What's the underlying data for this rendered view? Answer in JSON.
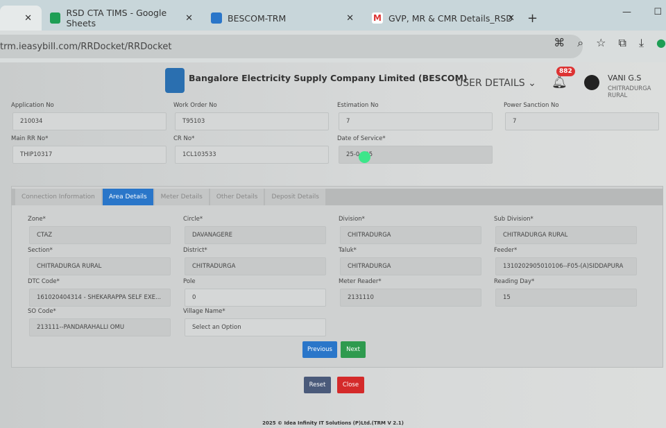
{
  "browser": {
    "tabs": [
      {
        "title": "",
        "close": "✕"
      },
      {
        "title": "RSD CTA TIMS - Google Sheets",
        "close": "✕"
      },
      {
        "title": "BESCOM-TRM",
        "close": "✕"
      },
      {
        "title": "GVP, MR & CMR Details_RSD",
        "close": "✕"
      }
    ],
    "new_tab": "+",
    "minimize": "—",
    "maximize": "☐",
    "url": "trm.ieasybill.com/RRDocket/RRDocket"
  },
  "header": {
    "company": "Bangalore Electricity Supply Company Limited (BESCOM)",
    "user_details": "USER DETAILS",
    "notifications": "882",
    "user_name": "VANI G.S",
    "user_location": "CHITRADURGA RURAL"
  },
  "top_fields": [
    {
      "label": "Application No",
      "value": "210034"
    },
    {
      "label": "Work Order No",
      "value": "T95103"
    },
    {
      "label": "Estimation No",
      "value": "7"
    },
    {
      "label": "Power Sanction No",
      "value": "7"
    },
    {
      "label": "Main RR No*",
      "value": "THIP10317"
    },
    {
      "label": "CR No*",
      "value": "1CL103533"
    },
    {
      "label": "Date of Service*",
      "value": "25-0  025"
    }
  ],
  "form_tabs": [
    "Connection Information",
    "Area Details",
    "Meter Details",
    "Other Details",
    "Deposit Details"
  ],
  "area_fields": [
    {
      "label": "Zone*",
      "value": "CTAZ"
    },
    {
      "label": "Circle*",
      "value": "DAVANAGERE"
    },
    {
      "label": "Division*",
      "value": "CHITRADURGA"
    },
    {
      "label": "Sub Division*",
      "value": "CHITRADURGA RURAL"
    },
    {
      "label": "Section*",
      "value": "CHITRADURGA RURAL"
    },
    {
      "label": "District*",
      "value": "CHITRADURGA"
    },
    {
      "label": "Taluk*",
      "value": "CHITRADURGA"
    },
    {
      "label": "Feeder*",
      "value": "1310202905010106--F05-(A)SIDDAPURA"
    },
    {
      "label": "DTC Code*",
      "value": "161020404314 - SHEKARAPPA SELF EXE..."
    },
    {
      "label": "Pole",
      "value": "0"
    },
    {
      "label": "Meter Reader*",
      "value": "2131110"
    },
    {
      "label": "Reading Day*",
      "value": "15"
    },
    {
      "label": "SO Code*",
      "value": "213111--PANDARAHALLI OMU"
    },
    {
      "label": "Village Name*",
      "value": "Select an Option"
    }
  ],
  "buttons": {
    "previous": "Previous",
    "next": "Next",
    "reset": "Reset",
    "close": "Close"
  },
  "footer": "2025 © Idea Infinity IT Solutions (P)Ltd.(TRM V 2.1)"
}
